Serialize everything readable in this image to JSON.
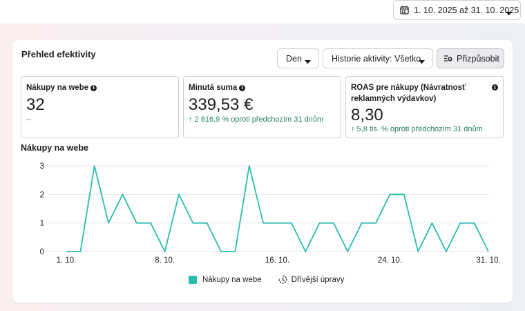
{
  "date_range": {
    "label": "1. 10. 2025 až 31. 10. 2025"
  },
  "panel": {
    "title": "Přehled efektivity",
    "granularity": "Den",
    "history": "Historie aktivity: Všetko",
    "customize": "Přizpůsobit"
  },
  "metrics": [
    {
      "label": "Nákupy na webe",
      "value": "32",
      "sub": "--"
    },
    {
      "label": "Minutá suma",
      "value": "339,53 €",
      "sub": "↑ 2 816,9 % oproti předchozím 31 dnům"
    },
    {
      "label": "ROAS pre nákupy (Návratnosť reklamných výdavkov)",
      "value": "8,30",
      "sub": "↑ 5,8 tis. % oproti předchozím 31 dnům"
    }
  ],
  "chart_data": {
    "type": "line",
    "title": "Nákupy na webe",
    "x": [
      1,
      2,
      3,
      4,
      5,
      6,
      7,
      8,
      9,
      10,
      11,
      12,
      13,
      14,
      15,
      16,
      17,
      18,
      19,
      20,
      21,
      22,
      23,
      24,
      25,
      26,
      27,
      28,
      29,
      30,
      31
    ],
    "x_tick_labels": [
      {
        "x": 1,
        "label": "1. 10."
      },
      {
        "x": 8,
        "label": "8. 10."
      },
      {
        "x": 16,
        "label": "16. 10."
      },
      {
        "x": 24,
        "label": "24. 10."
      },
      {
        "x": 31,
        "label": "31. 10."
      }
    ],
    "yticks": [
      0,
      1,
      2,
      3
    ],
    "ylim": [
      0,
      3
    ],
    "grid": true,
    "series": [
      {
        "name": "Nákupy na webe",
        "color": "#2bbbad",
        "values": [
          0,
          0,
          3,
          1,
          2,
          1,
          1,
          0,
          2,
          1,
          1,
          0,
          0,
          3,
          1,
          1,
          1,
          0,
          1,
          1,
          0,
          1,
          1,
          2,
          2,
          0,
          1,
          0,
          1,
          1,
          0
        ]
      }
    ],
    "legend": {
      "placement": "bottom-center",
      "prior_label": "Dřívější úpravy"
    }
  }
}
